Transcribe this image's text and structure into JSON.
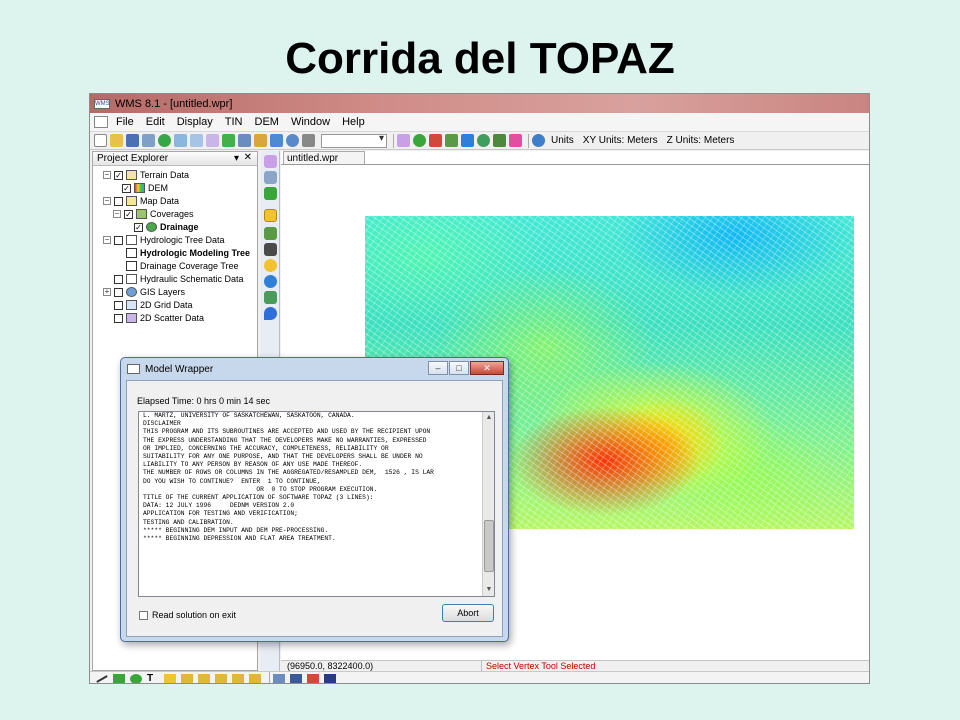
{
  "slide": {
    "title": "Corrida del TOPAZ"
  },
  "app": {
    "title": "WMS 8.1 - [untitled.wpr]",
    "menu": [
      "File",
      "Edit",
      "Display",
      "TIN",
      "DEM",
      "Window",
      "Help"
    ],
    "toolbar": {
      "units_label": "Units",
      "xy_units": "XY Units: Meters",
      "z_units": "Z Units: Meters",
      "combo_value": ""
    }
  },
  "project_explorer": {
    "title": "Project Explorer",
    "pin": "▾",
    "close": "✕",
    "items": [
      {
        "label": "Terrain Data",
        "bold": false
      },
      {
        "label": "DEM",
        "bold": false
      },
      {
        "label": "Map Data",
        "bold": false
      },
      {
        "label": "Coverages",
        "bold": false
      },
      {
        "label": "Drainage",
        "bold": true
      },
      {
        "label": "Hydrologic Tree Data",
        "bold": false
      },
      {
        "label": "Hydrologic Modeling Tree",
        "bold": true
      },
      {
        "label": "Drainage Coverage Tree",
        "bold": false
      },
      {
        "label": "Hydraulic Schematic Data",
        "bold": false
      },
      {
        "label": "GIS Layers",
        "bold": false
      },
      {
        "label": "2D Grid Data",
        "bold": false
      },
      {
        "label": "2D Scatter Data",
        "bold": false
      }
    ]
  },
  "graphics_window": {
    "tab": "untitled.wpr"
  },
  "statusbar": {
    "coords": "(96950.0, 8322400.0)",
    "message": "Select Vertex Tool Selected"
  },
  "dialog": {
    "title": "Model Wrapper",
    "elapsed": "Elapsed Time: 0 hrs 0 min 14 sec",
    "console_lines": [
      "L. MARTZ, UNIVERSITY OF SASKATCHEWAN, SASKATOON, CANADA.",
      "DISCLAIMER",
      "THIS PROGRAM AND ITS SUBROUTINES ARE ACCEPTED AND USED BY THE RECIPIENT UPON",
      "THE EXPRESS UNDERSTANDING THAT THE DEVELOPERS MAKE NO WARRANTIES, EXPRESSED",
      "OR IMPLIED, CONCERNING THE ACCURACY, COMPLETENESS, RELIABILITY OR",
      "SUITABILITY FOR ANY ONE PURPOSE, AND THAT THE DEVELOPERS SHALL BE UNDER NO",
      "LIABILITY TO ANY PERSON BY REASON OF ANY USE MADE THEREOF.",
      "THE NUMBER OF ROWS OR COLUMNS IN THE AGGREGATED/RESAMPLED DEM,  1526 , IS LAR",
      "DO YOU WISH TO CONTINUE?  ENTER  1 TO CONTINUE,",
      "                              OR  0 TO STOP PROGRAM EXECUTION.",
      "TITLE OF THE CURRENT APPLICATION OF SOFTWARE TOPAZ (3 LINES):",
      "DATA: 12 JULY 1996     DEDNM VERSION 2.0",
      "APPLICATION FOR TESTING AND VERIFICATION;",
      "TESTING AND CALIBRATION.",
      "***** BEGINNING DEM INPUT AND DEM PRE-PROCESSING.",
      "***** BEGINNING DEPRESSION AND FLAT AREA TREATMENT."
    ],
    "read_solution_label": "Read solution on exit",
    "abort_label": "Abort",
    "btn_min": "–",
    "btn_max": "□",
    "btn_close": "✕"
  }
}
